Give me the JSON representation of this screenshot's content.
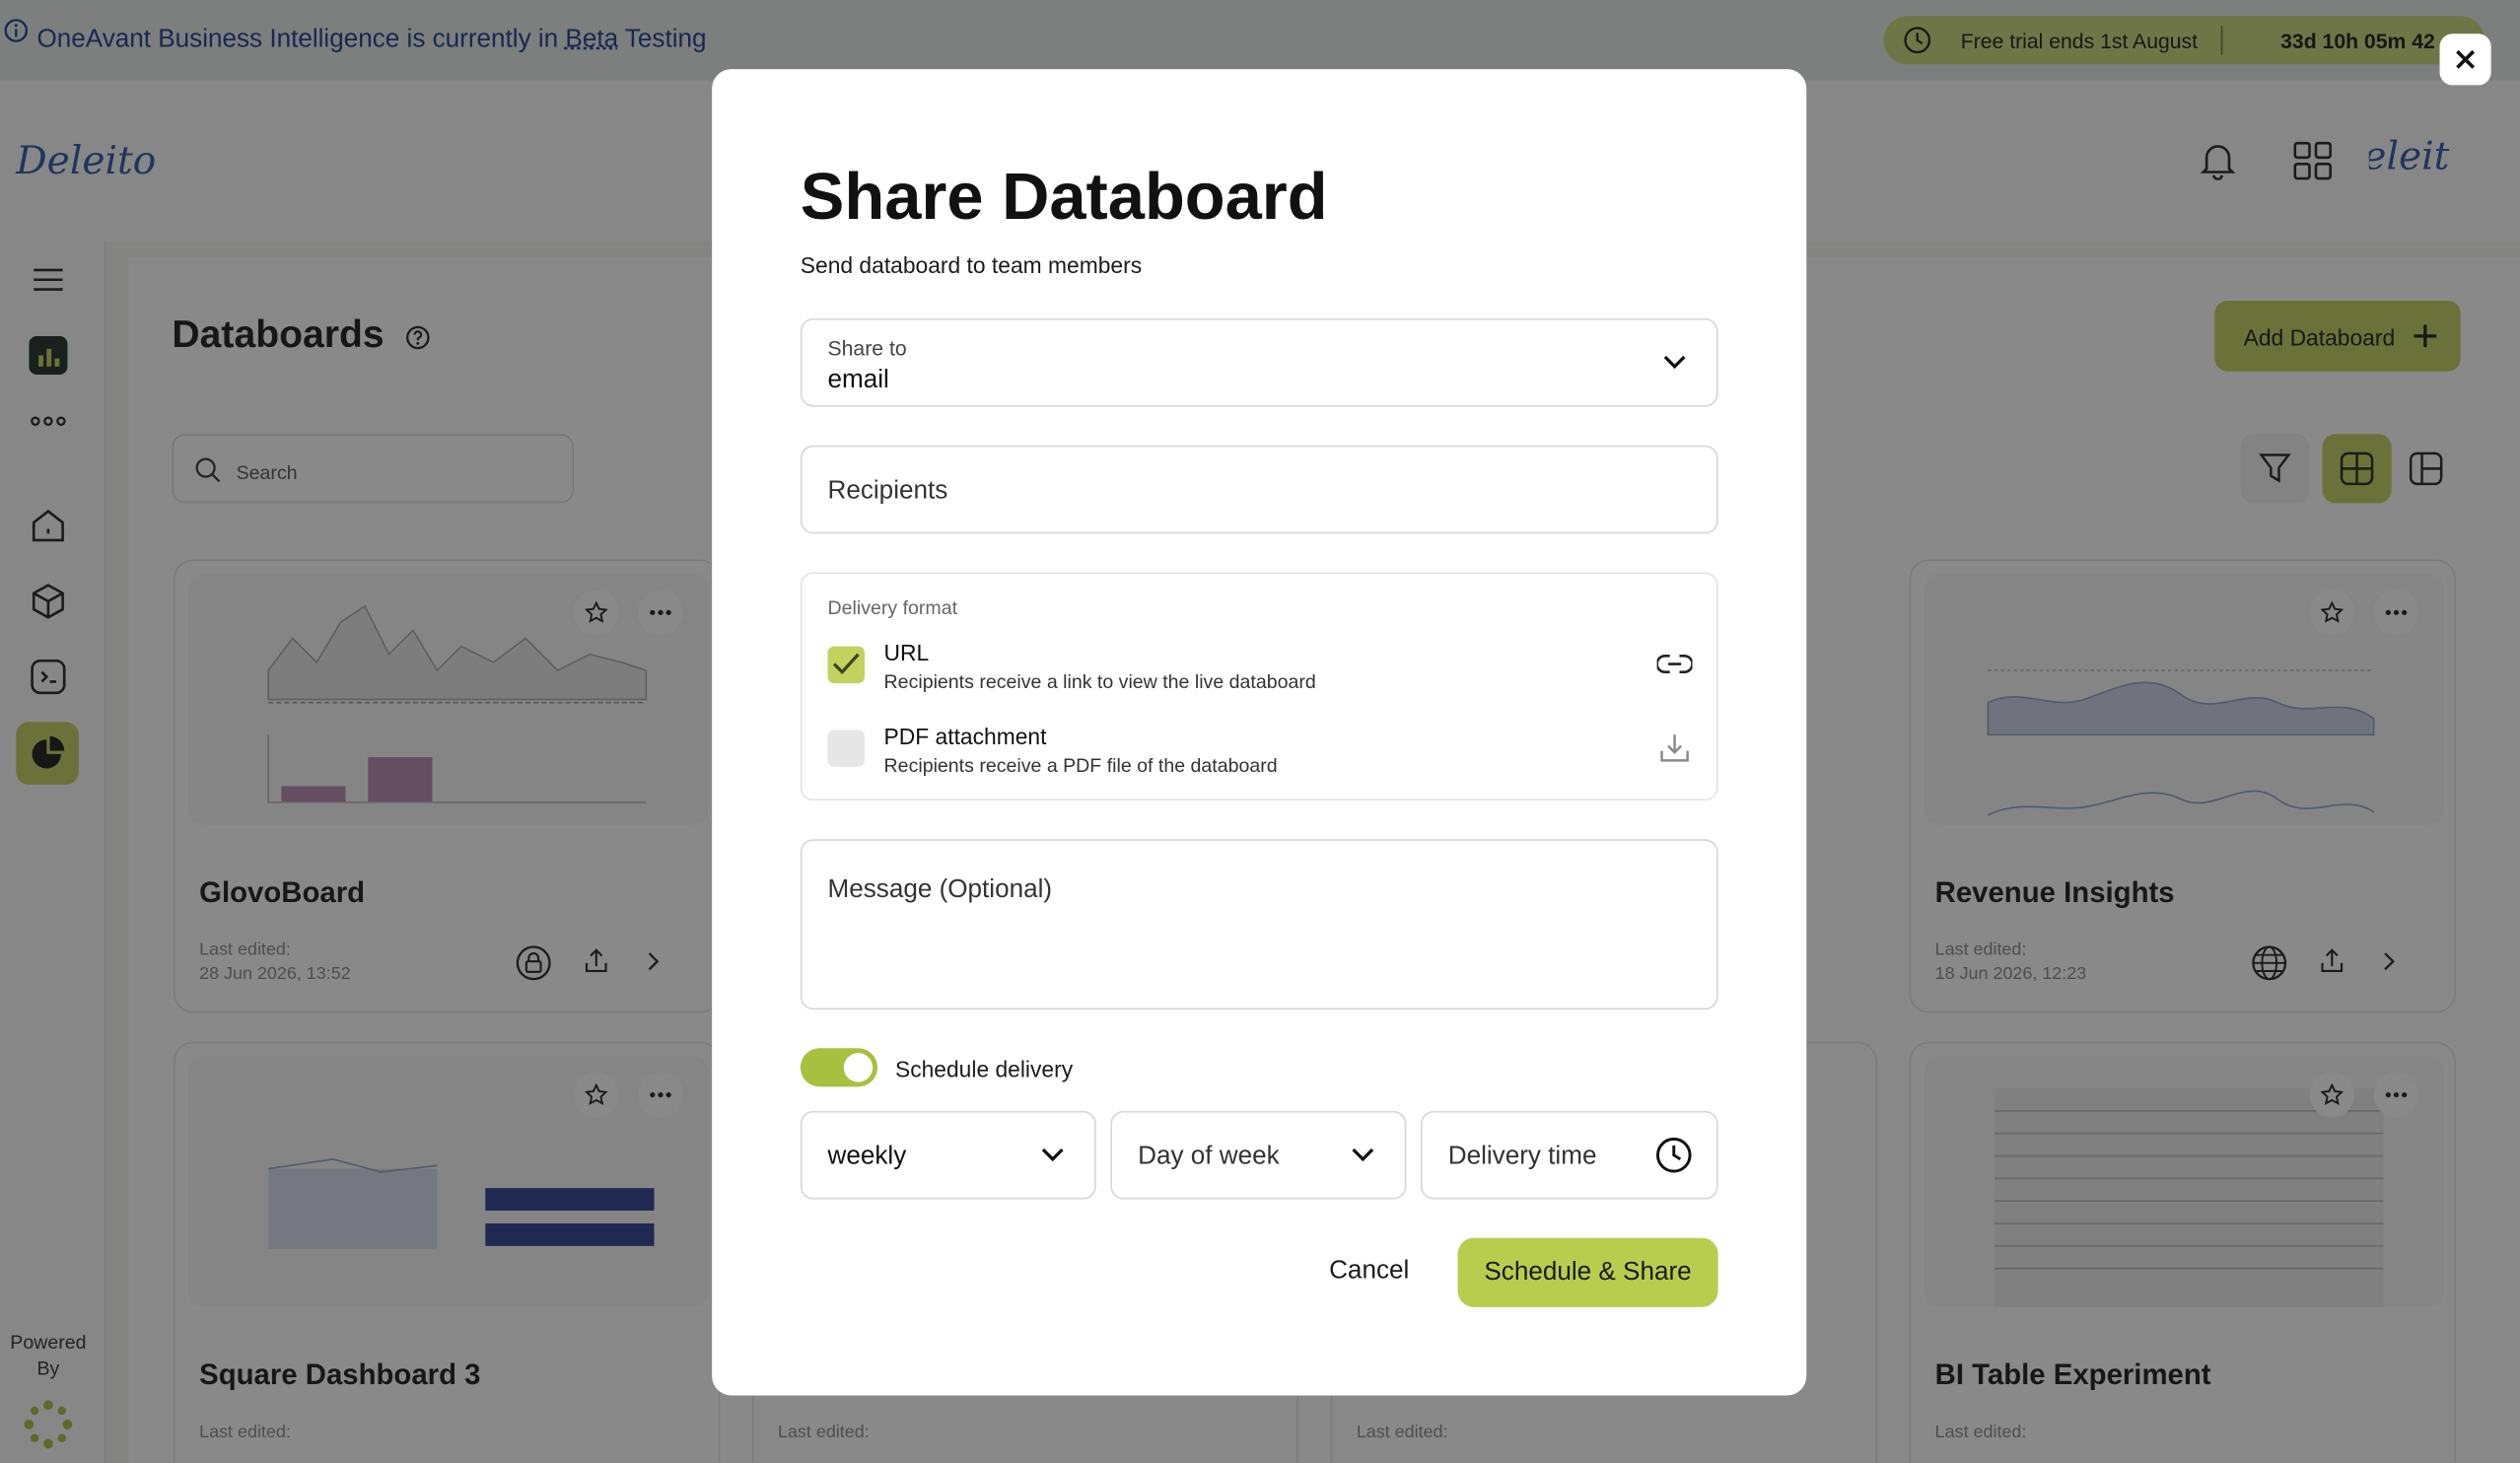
{
  "banner": {
    "text_part1": "OneAvant Business Intelligence is currently in ",
    "text_beta": "Beta",
    "text_part2": " Testing"
  },
  "trial": {
    "label": "Free trial ends 1st August",
    "countdown": "33d 10h 05m 42"
  },
  "brand": {
    "name": "Deleito",
    "name_right": "Deleit"
  },
  "page": {
    "title": "Databoards",
    "search_placeholder": "Search",
    "add_button": "Add Databoard"
  },
  "sidebar": {
    "powered_by": "Powered By"
  },
  "cards": [
    {
      "name": "GlovoBoard",
      "last_edited_label": "Last edited:",
      "date": "28 Jun 2026, 13:52"
    },
    {
      "name": "Revenue Insights",
      "last_edited_label": "Last edited:",
      "date": "18 Jun 2026, 12:23"
    },
    {
      "name": "Square Dashboard 3",
      "last_edited_label": "Last edited:",
      "date": ""
    },
    {
      "name": "",
      "last_edited_label": "Last edited:",
      "date": ""
    },
    {
      "name": "",
      "last_edited_label": "Last edited:",
      "date": ""
    },
    {
      "name": "BI Table Experiment",
      "last_edited_label": "Last edited:",
      "date": ""
    }
  ],
  "modal": {
    "title": "Share Databoard",
    "subtitle": "Send databoard to team members",
    "share_to": {
      "label": "Share to",
      "value": "email"
    },
    "recipients_placeholder": "Recipients",
    "delivery_format": {
      "label": "Delivery format",
      "options": [
        {
          "title": "URL",
          "description": "Recipients receive a link to view the live databoard",
          "checked": true,
          "icon": "link-icon"
        },
        {
          "title": "PDF attachment",
          "description": "Recipients receive a PDF file of the databoard",
          "checked": false,
          "icon": "download-icon"
        }
      ]
    },
    "message_placeholder": "Message (Optional)",
    "schedule": {
      "label": "Schedule delivery",
      "enabled": true
    },
    "frequency": "weekly",
    "day_placeholder": "Day of week",
    "time_placeholder": "Delivery time",
    "cancel": "Cancel",
    "submit": "Schedule & Share"
  },
  "colors": {
    "accent": "#c3d15f",
    "primary_button": "#b8cd4e",
    "banner_text": "#1a3e8f",
    "overlay": "rgba(20,20,20,0.5)"
  }
}
